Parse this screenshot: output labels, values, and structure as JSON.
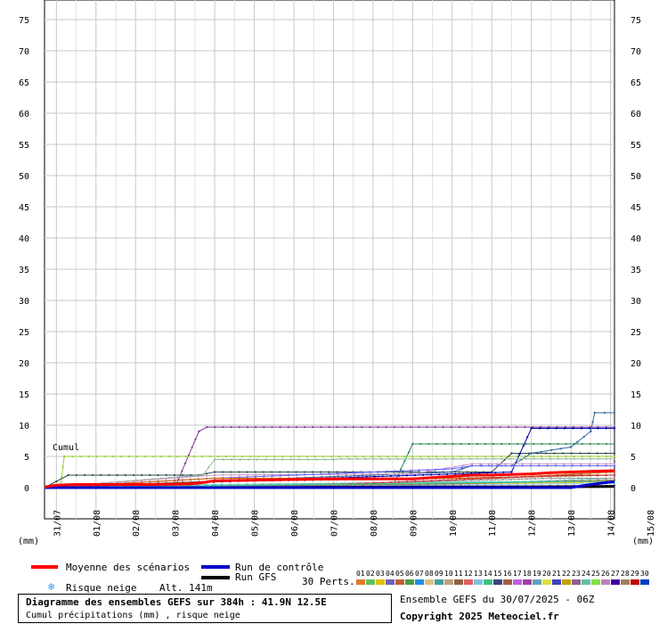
{
  "chart_data": {
    "type": "line",
    "ylim": [
      0,
      75
    ],
    "ylabel": "(mm)",
    "y_ticks": [
      0,
      5,
      10,
      15,
      20,
      25,
      30,
      35,
      40,
      45,
      50,
      55,
      60,
      65,
      70,
      75
    ],
    "x_ticks": [
      "31/07",
      "01/08",
      "02/08",
      "03/08",
      "04/08",
      "05/08",
      "06/08",
      "07/08",
      "08/08",
      "09/08",
      "10/08",
      "11/08",
      "12/08",
      "13/08",
      "14/08",
      "15/08"
    ],
    "annotation": "Cumul",
    "grid": true,
    "series": [
      {
        "name": "Moyenne des scénarios",
        "color": "#ff0000",
        "width": 3,
        "x": [
          30.7,
          31.0,
          31.5,
          32.5,
          33.5,
          34.4,
          34.7,
          35.0,
          36.0,
          37.0,
          38.0,
          39.0,
          40.0,
          40.5,
          41.0,
          41.5,
          42.0,
          42.5,
          43.0,
          43.5,
          44.0,
          44.5,
          45.0,
          45.1
        ],
        "y": [
          0.1,
          0.4,
          0.5,
          0.5,
          0.5,
          0.6,
          0.8,
          1.1,
          1.2,
          1.3,
          1.4,
          1.4,
          1.4,
          1.6,
          1.8,
          2.0,
          2.0,
          2.1,
          2.2,
          2.4,
          2.5,
          2.6,
          2.7,
          2.7
        ]
      },
      {
        "name": "Run de contrôle",
        "color": "#0000cc",
        "width": 3,
        "x": [
          30.7,
          31.0,
          35.0,
          40.0,
          41.0,
          42.0,
          43.0,
          44.0,
          44.5,
          45.0,
          45.1
        ],
        "y": [
          0,
          0,
          0,
          0,
          0,
          0,
          0,
          0,
          0.5,
          0.9,
          0.9
        ]
      },
      {
        "name": "Run GFS",
        "color": "#000000",
        "width": 3,
        "x": [
          30.7,
          31.0,
          35.0,
          40.0,
          43.0,
          45.1
        ],
        "y": [
          0,
          0,
          0,
          0.1,
          0.1,
          0.2
        ]
      },
      {
        "name": "01",
        "color": "#7f3f98",
        "width": 1,
        "x": [
          30.7,
          31.0,
          34.0,
          34.6,
          34.8,
          45.1
        ],
        "y": [
          0,
          0.1,
          0.1,
          9.0,
          9.7,
          9.7
        ]
      },
      {
        "name": "02",
        "color": "#2e8b57",
        "width": 1,
        "x": [
          30.7,
          31.0,
          39.5,
          40.0,
          45.1
        ],
        "y": [
          0,
          0.2,
          0.2,
          7.0,
          7.0
        ]
      },
      {
        "name": "03",
        "color": "#99cc33",
        "width": 1,
        "x": [
          30.7,
          31.1,
          31.2,
          45.1
        ],
        "y": [
          0,
          0,
          5.0,
          5.0
        ]
      },
      {
        "name": "04",
        "color": "#2f4f4f",
        "width": 1,
        "x": [
          30.7,
          31.0,
          31.3,
          34.6,
          35.0,
          42.0,
          42.5,
          45.1
        ],
        "y": [
          0,
          1.0,
          2.0,
          2.0,
          2.5,
          2.5,
          5.5,
          5.5
        ]
      },
      {
        "name": "05",
        "color": "#0000aa",
        "width": 1,
        "x": [
          30.7,
          42.5,
          43.0,
          45.1
        ],
        "y": [
          0,
          2.5,
          9.5,
          9.5
        ]
      },
      {
        "name": "06",
        "color": "#336699",
        "width": 1,
        "x": [
          30.7,
          41.0,
          41.5,
          42.5,
          43.0,
          44.0,
          44.5,
          44.6,
          45.1
        ],
        "y": [
          0,
          2.5,
          3.5,
          3.5,
          5.5,
          6.5,
          9.0,
          12.0,
          12.0
        ]
      },
      {
        "name": "07",
        "color": "#8fbc8f",
        "width": 1,
        "x": [
          30.7,
          34.7,
          35.0,
          38.0,
          38.2,
          45.1
        ],
        "y": [
          0,
          2.0,
          4.5,
          4.5,
          4.6,
          4.6
        ]
      },
      {
        "name": "08",
        "color": "#cc99cc",
        "width": 1,
        "x": [
          30.7,
          35.0,
          40.0,
          41.5,
          45.1
        ],
        "y": [
          0,
          2.0,
          2.2,
          3.8,
          3.8
        ]
      },
      {
        "name": "09",
        "color": "#a0522d",
        "width": 1,
        "x": [
          30.7,
          35.0,
          41.0,
          45.1
        ],
        "y": [
          0,
          1.0,
          1.5,
          2.0
        ]
      },
      {
        "name": "10",
        "color": "#6666ff",
        "width": 1,
        "x": [
          30.7,
          35.0,
          41.0,
          41.5,
          45.1
        ],
        "y": [
          0,
          1.5,
          3.0,
          3.5,
          3.5
        ]
      },
      {
        "name": "11",
        "color": "#cc6600",
        "width": 1,
        "x": [
          30.7,
          35.0,
          42.0,
          45.1
        ],
        "y": [
          0,
          1.5,
          1.5,
          2.5
        ]
      },
      {
        "name": "12",
        "color": "#66cccc",
        "width": 1,
        "x": [
          30.7,
          35.0,
          43.0,
          45.1
        ],
        "y": [
          0,
          0.5,
          1.0,
          1.5
        ]
      },
      {
        "name": "13",
        "color": "#ffcc00",
        "width": 1,
        "x": [
          30.7,
          36.0,
          44.0,
          45.1
        ],
        "y": [
          0,
          0.3,
          0.8,
          1.0
        ]
      },
      {
        "name": "14",
        "color": "#999999",
        "width": 1,
        "x": [
          30.7,
          37.0,
          43.5,
          45.1
        ],
        "y": [
          0,
          0.4,
          1.5,
          1.5
        ]
      },
      {
        "name": "15",
        "color": "#cc3333",
        "width": 1,
        "x": [
          30.7,
          38.0,
          44.0,
          45.1
        ],
        "y": [
          0,
          0.5,
          2.0,
          2.0
        ]
      },
      {
        "name": "16",
        "color": "#663399",
        "width": 1,
        "x": [
          30.7,
          40.0,
          45.1
        ],
        "y": [
          0,
          0.2,
          0.3
        ]
      },
      {
        "name": "17",
        "color": "#99ccff",
        "width": 1,
        "x": [
          30.7,
          39.0,
          45.1
        ],
        "y": [
          0,
          0.3,
          0.7
        ]
      },
      {
        "name": "18",
        "color": "#996633",
        "width": 1,
        "x": [
          30.7,
          41.0,
          45.1
        ],
        "y": [
          0,
          0.6,
          1.2
        ]
      },
      {
        "name": "19",
        "color": "#33cc99",
        "width": 1,
        "x": [
          30.7,
          42.0,
          45.1
        ],
        "y": [
          0,
          0.8,
          1.0
        ]
      }
    ]
  },
  "legend": {
    "mean": "Moyenne des scénarios",
    "control": "Run de contrôle",
    "gfs": "Run GFS",
    "snow": "Risque neige",
    "alt": "Alt. 141m",
    "perts": "30 Perts.",
    "pert_numbers": [
      "01",
      "02",
      "03",
      "04",
      "05",
      "06",
      "07",
      "08",
      "09",
      "10",
      "11",
      "12",
      "13",
      "14",
      "15",
      "16",
      "17",
      "18",
      "19",
      "20",
      "21",
      "22",
      "23",
      "24",
      "25",
      "26",
      "27",
      "28",
      "29",
      "30"
    ],
    "pert_colors": [
      "#e07830",
      "#60c060",
      "#e0c000",
      "#7060c0",
      "#c06030",
      "#40a040",
      "#2090e0",
      "#e0c080",
      "#40a0a0",
      "#c0a080",
      "#906040",
      "#e06060",
      "#80c0e0",
      "#40c080",
      "#404080",
      "#a06040",
      "#c060e0",
      "#a040a0",
      "#60a0c0",
      "#e0e040",
      "#4040c0",
      "#c0a000",
      "#906090",
      "#60c0a0",
      "#80e040",
      "#c080c0",
      "#4000a0",
      "#a08060",
      "#c00000",
      "#0040c0"
    ]
  },
  "footer": {
    "title": "Diagramme des ensembles GEFS sur 384h : 41.9N 12.5E",
    "subtitle": "Cumul précipitations (mm) , risque neige",
    "run": "Ensemble GEFS du 30/07/2025 - 06Z",
    "copyright": "Copyright 2025 Meteociel.fr"
  }
}
